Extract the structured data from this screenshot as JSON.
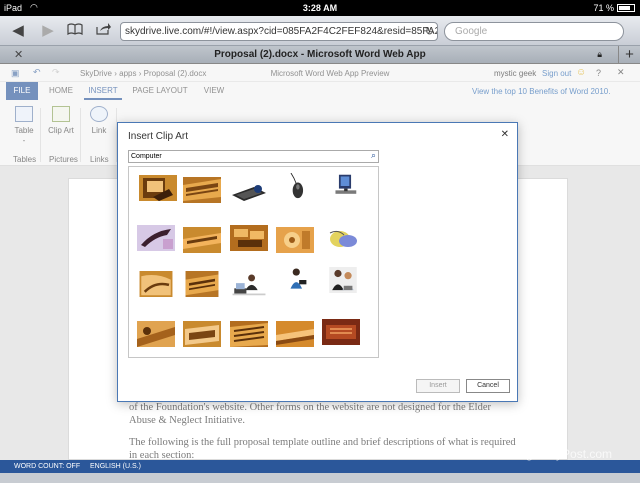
{
  "status_bar": {
    "device": "iPad",
    "time": "3:28 AM",
    "battery": "71 %"
  },
  "browser": {
    "url": "skydrive.live.com/#!/view.aspx?cid=085FA2F4C2FEF824&resid=85FA2F",
    "search_placeholder": "Google",
    "tab_title": "Proposal (2).docx - Microsoft Word Web App"
  },
  "app": {
    "breadcrumb": [
      "SkyDrive",
      "apps",
      "Proposal (2).docx"
    ],
    "title": "Microsoft Word Web App Preview",
    "user": "mystic geek",
    "sign_out": "Sign out"
  },
  "ribbon": {
    "tabs": [
      "FILE",
      "HOME",
      "INSERT",
      "PAGE LAYOUT",
      "VIEW"
    ],
    "active_tab": "INSERT",
    "promo": "View the top 10 Benefits of Word 2010.",
    "buttons": {
      "table": "Table",
      "table_sub": "-",
      "clipart": "Clip Art",
      "link": "Link"
    },
    "groups": [
      "Tables",
      "Pictures",
      "Links"
    ]
  },
  "document": {
    "paragraphs": [
      "of the Foundation's website. Other forms on the website are not designed for the Elder Abuse & Neglect Initiative.",
      "The following is the full proposal template outline and brief descriptions of what is required in each section:"
    ]
  },
  "dialog": {
    "title": "Insert Clip Art",
    "search_value": "Computer",
    "insert_label": "Insert",
    "cancel_label": "Cancel"
  },
  "status": {
    "word_count": "WORD COUNT: OFF",
    "language": "ENGLISH (U.S.)"
  },
  "watermark": "groovyPost.com",
  "colors": {
    "accent": "#2b579a",
    "dialog_border": "#4a78b5"
  }
}
